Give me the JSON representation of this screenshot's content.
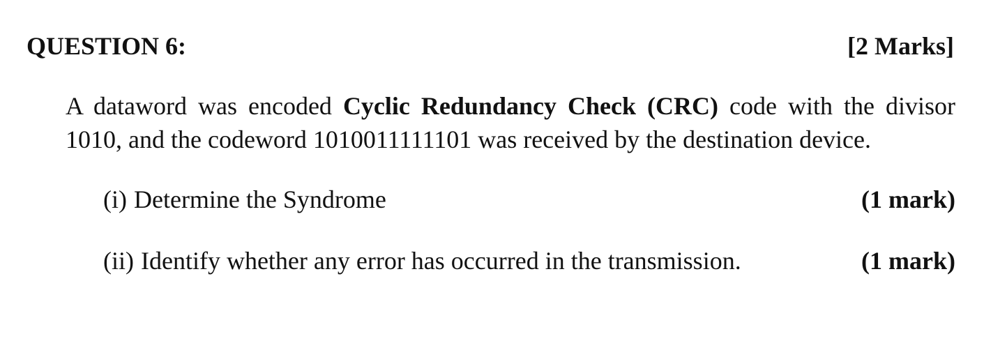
{
  "question": {
    "title": "QUESTION 6:",
    "marks": "[2 Marks]"
  },
  "intro": {
    "part1": "A dataword was encoded ",
    "bold": "Cyclic Redundancy Check (CRC)",
    "part2": " code with the divisor 1010, and the codeword 1010011111101 was received by the destination device."
  },
  "subquestions": [
    {
      "number": "(i)",
      "text": "Determine the Syndrome",
      "marks": "(1 mark)"
    },
    {
      "number": "(ii)",
      "text": "Identify whether any error has occurred in the transmission.",
      "marks": "(1 mark)"
    }
  ]
}
